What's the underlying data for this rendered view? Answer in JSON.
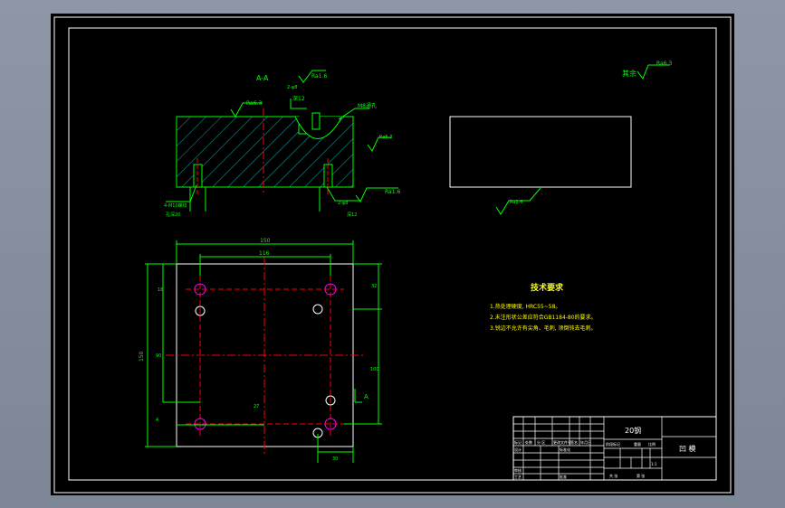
{
  "colors": {
    "background": "#000000",
    "frame": "#ffffff",
    "green": "#00ff00",
    "red": "#ff0000",
    "cyan": "#00c8c8",
    "yellow": "#ffff00",
    "magenta": "#ff00ff",
    "chrome": "#8d97a6"
  },
  "section_label": "A-A",
  "roughness": {
    "general": "Ra6.3",
    "top_surface": "Ra1.6",
    "left_face": "Ra6.3",
    "right_face": "Ra6.3",
    "bottom_face": "Ra1.6",
    "bottom_view": "Ra1.6"
  },
  "other_note": "其余",
  "hole_notes": {
    "pin_hole": "2-φ8",
    "pin_depth": "深12",
    "thread_top": "M8通孔",
    "bolt_holes": "4-M10螺纹",
    "bolt_depth": "孔深20",
    "counterbore": "2-φ8",
    "counterbore_depth": "深12"
  },
  "dimensions": {
    "overall_width": "150",
    "hole_spacing_x": "116",
    "overall_height": "150",
    "hole_spacing_y": "116",
    "left_top": "16",
    "left_mid": "90",
    "right_top": "32",
    "right_mid": "100",
    "bottom_offset": "27",
    "bottom_right": "30",
    "left_small": "4"
  },
  "section_mark": "A",
  "tech_req": {
    "title": "技术要求",
    "items": [
      "1.热处理硬度, HRC55~58。",
      "2.未注形状公差应符合GB1184-80的要求。",
      "3.锐边不允许有尖角、毛刺, 须倒钝去毛刺。"
    ]
  },
  "title_block": {
    "material": "20钢",
    "part_name": "凹 模",
    "cells": {
      "mark": "标记",
      "count": "处数",
      "zone": "分 区",
      "change_doc": "更改文件号",
      "signature": "签名",
      "date": "年月日",
      "design": "设计",
      "standard": "标准化",
      "review": "审核",
      "process": "工艺",
      "approve": "批准",
      "stage_mark": "阶段标记",
      "weight": "重量",
      "scale": "比例",
      "sheet_total": "共 张",
      "sheet_no": "第 张",
      "scale_value": "1:1"
    }
  }
}
